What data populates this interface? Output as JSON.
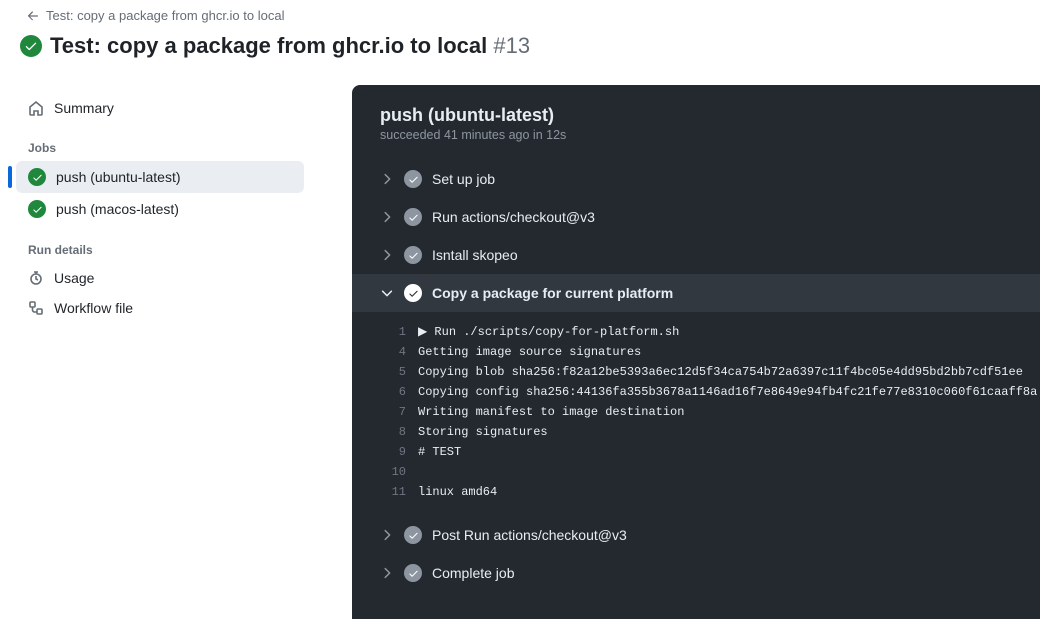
{
  "back_label": "Test: copy a package from ghcr.io to local",
  "title": "Test: copy a package from ghcr.io to local",
  "title_num": "#13",
  "sidebar": {
    "summary": "Summary",
    "jobs_heading": "Jobs",
    "job1": "push (ubuntu-latest)",
    "job2": "push (macos-latest)",
    "run_details_heading": "Run details",
    "usage": "Usage",
    "workflow_file": "Workflow file"
  },
  "job": {
    "title": "push (ubuntu-latest)",
    "status": "succeeded",
    "when": "41 minutes ago",
    "in_word": "in",
    "duration": "12s"
  },
  "steps": {
    "s1": "Set up job",
    "s2": "Run actions/checkout@v3",
    "s3": "Isntall skopeo",
    "s4": "Copy a package for current platform",
    "s5": "Post Run actions/checkout@v3",
    "s6": "Complete job"
  },
  "log": {
    "run_cmd": "Run ./scripts/copy-for-platform.sh",
    "lines": [
      {
        "n": "1",
        "t": "▶ Run ./scripts/copy-for-platform.sh"
      },
      {
        "n": "4",
        "t": "Getting image source signatures"
      },
      {
        "n": "5",
        "t": "Copying blob sha256:f82a12be5393a6ec12d5f34ca754b72a6397c11f4bc05e4dd95bd2bb7cdf51ee"
      },
      {
        "n": "6",
        "t": "Copying config sha256:44136fa355b3678a1146ad16f7e8649e94fb4fc21fe77e8310c060f61caaff8a"
      },
      {
        "n": "7",
        "t": "Writing manifest to image destination"
      },
      {
        "n": "8",
        "t": "Storing signatures"
      },
      {
        "n": "9",
        "t": "# TEST"
      },
      {
        "n": "10",
        "t": ""
      },
      {
        "n": "11",
        "t": "linux amd64"
      }
    ]
  }
}
